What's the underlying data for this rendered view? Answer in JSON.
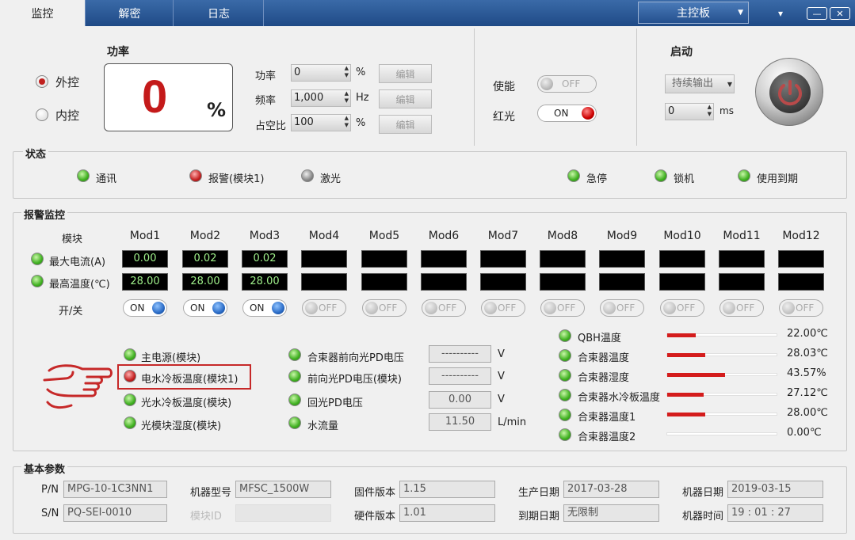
{
  "tabs": [
    "监控",
    "解密",
    "日志"
  ],
  "main_control": "主控板",
  "window_buttons": [
    "▾",
    "—",
    "✕"
  ],
  "power_panel": {
    "title": "功率",
    "external": "外控",
    "internal": "内控",
    "value": "0",
    "unit": "%",
    "params": [
      {
        "label": "功率",
        "value": "0",
        "unit": "%",
        "edit": "编辑"
      },
      {
        "label": "频率",
        "value": "1,000",
        "unit": "Hz",
        "edit": "编辑"
      },
      {
        "label": "占空比",
        "value": "100",
        "unit": "%",
        "edit": "编辑"
      }
    ]
  },
  "enable_panel": {
    "enable_label": "使能",
    "enable_state": "OFF",
    "redlight_label": "红光",
    "redlight_state": "ON"
  },
  "start_panel": {
    "title": "启动",
    "mode": "持续输出",
    "ms_value": "0",
    "ms_unit": "ms"
  },
  "status": {
    "title": "状态",
    "items": [
      {
        "label": "通讯",
        "color": "green"
      },
      {
        "label": "报警(模块1)",
        "color": "red"
      },
      {
        "label": "激光",
        "color": "gray"
      },
      {
        "label": "急停",
        "color": "green"
      },
      {
        "label": "锁机",
        "color": "green"
      },
      {
        "label": "使用到期",
        "color": "green"
      }
    ]
  },
  "alarm": {
    "title": "报警监控",
    "module_label": "模块",
    "max_current_label": "最大电流(A)",
    "max_temp_label": "最高温度(℃)",
    "switch_label": "开/关",
    "modules": [
      {
        "name": "Mod1",
        "current": "0.00",
        "temp": "28.00",
        "switch": "ON"
      },
      {
        "name": "Mod2",
        "current": "0.02",
        "temp": "28.00",
        "switch": "ON"
      },
      {
        "name": "Mod3",
        "current": "0.02",
        "temp": "28.00",
        "switch": "ON"
      },
      {
        "name": "Mod4",
        "current": "",
        "temp": "",
        "switch": "OFF"
      },
      {
        "name": "Mod5",
        "current": "",
        "temp": "",
        "switch": "OFF"
      },
      {
        "name": "Mod6",
        "current": "",
        "temp": "",
        "switch": "OFF"
      },
      {
        "name": "Mod7",
        "current": "",
        "temp": "",
        "switch": "OFF"
      },
      {
        "name": "Mod8",
        "current": "",
        "temp": "",
        "switch": "OFF"
      },
      {
        "name": "Mod9",
        "current": "",
        "temp": "",
        "switch": "OFF"
      },
      {
        "name": "Mod10",
        "current": "",
        "temp": "",
        "switch": "OFF"
      },
      {
        "name": "Mod11",
        "current": "",
        "temp": "",
        "switch": "OFF"
      },
      {
        "name": "Mod12",
        "current": "",
        "temp": "",
        "switch": "OFF"
      }
    ],
    "left_items": [
      {
        "label": "主电源(模块)",
        "color": "green"
      },
      {
        "label": "电水冷板温度(模块1)",
        "color": "red"
      },
      {
        "label": "光水冷板温度(模块)",
        "color": "green"
      },
      {
        "label": "光模块湿度(模块)",
        "color": "green"
      }
    ],
    "mid_items": [
      {
        "label": "合束器前向光PD电压",
        "value": "----------",
        "unit": "V"
      },
      {
        "label": "前向光PD电压(模块)",
        "value": "----------",
        "unit": "V"
      },
      {
        "label": "回光PD电压",
        "value": "0.00",
        "unit": "V"
      },
      {
        "label": "水流量",
        "value": "11.50",
        "unit": "L/min"
      }
    ],
    "right_items": [
      {
        "label": "QBH温度",
        "value": "22.00℃",
        "level": 0.26
      },
      {
        "label": "合束器温度",
        "value": "28.03℃",
        "level": 0.34
      },
      {
        "label": "合束器湿度",
        "value": "43.57%",
        "level": 0.52
      },
      {
        "label": "合束器水冷板温度",
        "value": "27.12℃",
        "level": 0.33
      },
      {
        "label": "合束器温度1",
        "value": "28.00℃",
        "level": 0.34
      },
      {
        "label": "合束器温度2",
        "value": "0.00℃",
        "level": 0
      }
    ]
  },
  "basic": {
    "title": "基本参数",
    "rows": [
      [
        {
          "label": "P/N",
          "value": "MPG-10-1C3NN1"
        },
        {
          "label": "机器型号",
          "value": "MFSC_1500W"
        },
        {
          "label": "固件版本",
          "value": "1.15"
        },
        {
          "label": "生产日期",
          "value": "2017-03-28"
        },
        {
          "label": "机器日期",
          "value": "2019-03-15"
        }
      ],
      [
        {
          "label": "S/N",
          "value": "PQ-SEI-0010"
        },
        {
          "label": "模块ID",
          "value": ""
        },
        {
          "label": "硬件版本",
          "value": "1.01"
        },
        {
          "label": "到期日期",
          "value": "无限制"
        },
        {
          "label": "机器时间",
          "value": "19 : 01 : 27"
        }
      ]
    ]
  }
}
